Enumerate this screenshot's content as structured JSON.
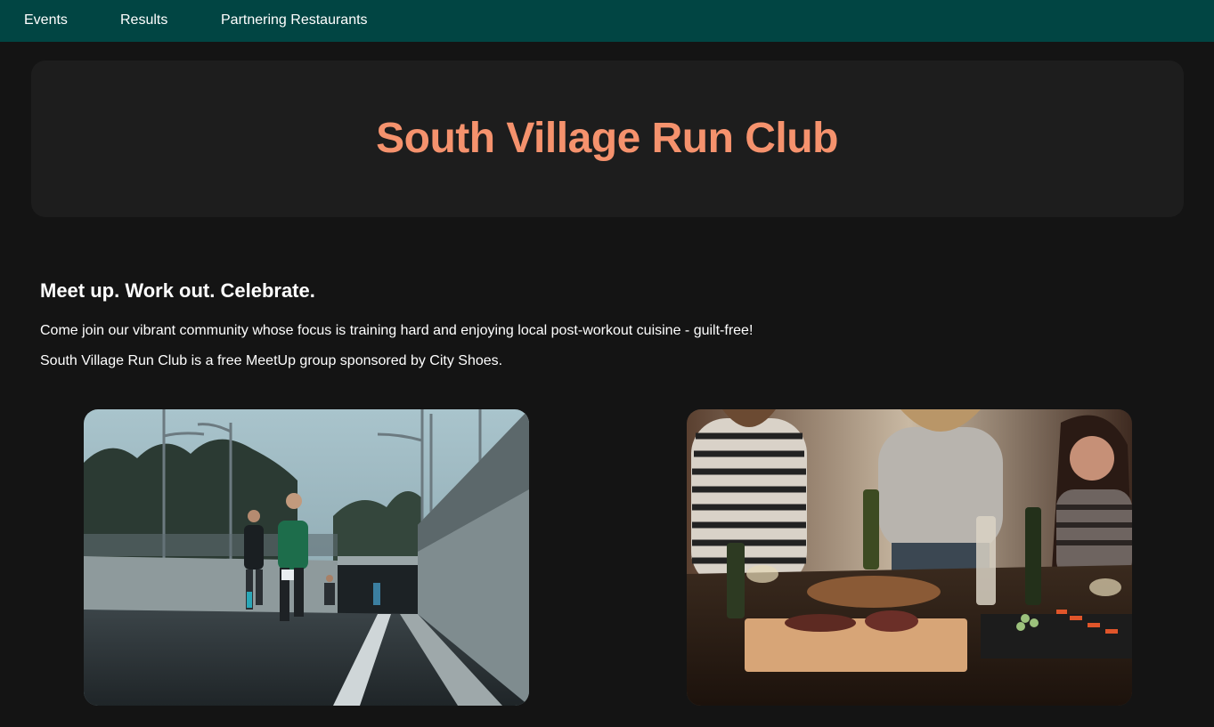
{
  "nav": {
    "items": [
      {
        "label": "Events"
      },
      {
        "label": "Results"
      },
      {
        "label": "Partnering Restaurants"
      }
    ]
  },
  "hero": {
    "title": "South Village Run Club"
  },
  "intro": {
    "heading": "Meet up. Work out. Celebrate.",
    "paragraph1": "Come join our vibrant community whose focus is training hard and enjoying local post-workout cuisine - guilt-free!",
    "paragraph2": "South Village Run Club is a free MeetUp group sponsored by City Shoes."
  },
  "images": [
    {
      "subject": "runners-on-road-photo"
    },
    {
      "subject": "friends-dining-photo"
    }
  ],
  "colors": {
    "nav_bg": "#014543",
    "page_bg": "#141414",
    "hero_bg": "#1d1d1d",
    "accent": "#f5926d"
  }
}
